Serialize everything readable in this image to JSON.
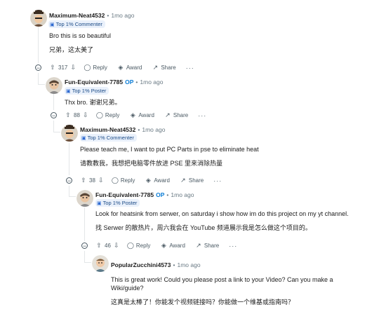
{
  "comments": [
    {
      "author": "Maximum-Neat4532",
      "op": "",
      "time": "1mo ago",
      "flair": "Top 1% Commenter",
      "body": [
        "Bro this is so beautiful",
        "兄弟，这太美了"
      ],
      "votes": "317"
    },
    {
      "author": "Fun-Equivalent-7785",
      "op": "OP",
      "time": "1mo ago",
      "flair": "Top 1% Poster",
      "body": [
        "Thx bro.  谢谢兄弟。"
      ],
      "votes": "88"
    },
    {
      "author": "Maximum-Neat4532",
      "op": "",
      "time": "1mo ago",
      "flair": "Top 1% Commenter",
      "body": [
        "Please teach me, I want to put PC Parts in pse to eliminate heat",
        "请教教我，我想把电脑零件放进 PSE 里来消除热量"
      ],
      "votes": "38"
    },
    {
      "author": "Fun-Equivalent-7785",
      "op": "OP",
      "time": "1mo ago",
      "flair": "Top 1% Poster",
      "body": [
        "Look for heatsink from serwer, on saturday i show how im do this project on my yt channel.",
        "找 Serwer 的散热片，周六我会在 YouTube 频道展示我是怎么做这个项目的。"
      ],
      "votes": "46"
    },
    {
      "author": "PopularZucchini4573",
      "op": "",
      "time": "1mo ago",
      "flair": "",
      "body": [
        "This is great work! Could you please post a link to your Video? Can you make a",
        "Wiki/guide?",
        "这真是太棒了！你能发个视频链接吗？你能做一个维基或指南吗？"
      ],
      "votes": ""
    }
  ],
  "labels": {
    "reply": "Reply",
    "award": "Award",
    "share": "Share",
    "dot": "•",
    "more": "···"
  },
  "icons": {
    "upvote": "arrow-up-icon",
    "downvote": "arrow-down-icon",
    "reply": "comment-bubble-icon",
    "award": "award-icon",
    "share": "share-icon",
    "collapse": "minus-circle-icon",
    "flair": "trophy-icon"
  }
}
